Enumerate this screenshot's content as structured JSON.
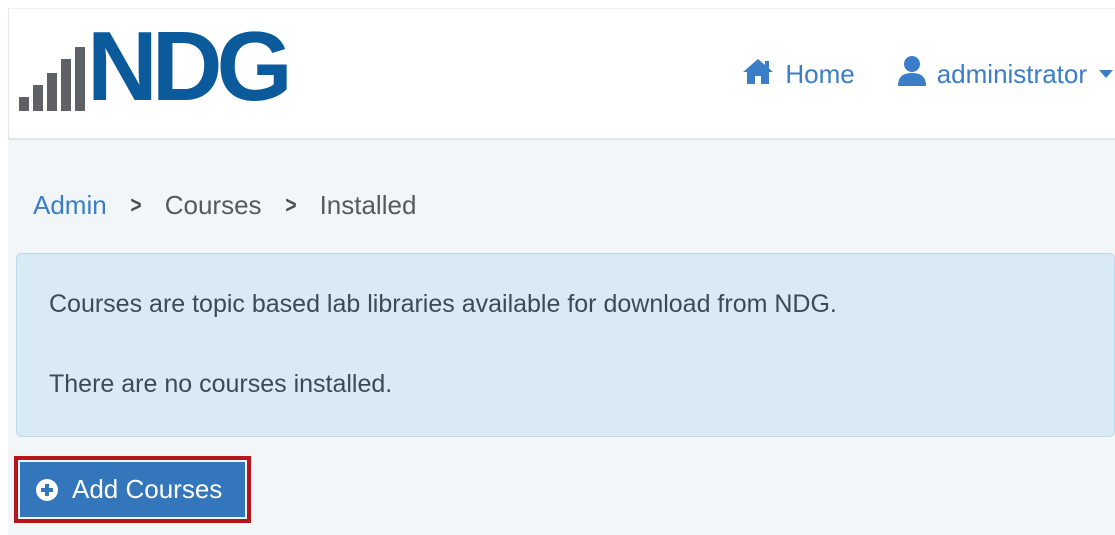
{
  "header": {
    "logo_text": "NDG",
    "nav": {
      "home_label": "Home",
      "home_icon": "home-icon",
      "user_label": "administrator",
      "user_icon": "user-icon",
      "user_menu_icon": "caret-down-icon"
    }
  },
  "breadcrumb": {
    "items": [
      "Admin",
      "Courses",
      "Installed"
    ],
    "separator_icon": "chevron-right-icon"
  },
  "alert": {
    "line1": "Courses are topic based lab libraries available for download from NDG.",
    "line2": "There are no courses installed."
  },
  "actions": {
    "add_courses_label": "Add Courses",
    "add_courses_icon": "plus-circle-icon"
  },
  "colors": {
    "brand_blue": "#0b5a9c",
    "link_blue": "#3a7dc9",
    "button_blue": "#3376bb",
    "alert_bg": "#d9eaf5",
    "highlight_red": "#b8151b",
    "page_bg": "#f3f6f9"
  }
}
